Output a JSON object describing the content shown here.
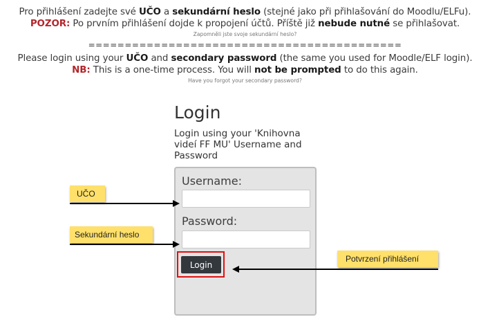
{
  "instructions_cs": {
    "l1_pre": "Pro přihlášení zadejte své ",
    "l1_uco": "UČO",
    "l1_mid": " a ",
    "l1_sec": "sekundární heslo",
    "l1_post": " (stejné jako při přihlašování do Moodlu/ELFu).",
    "l2_pozor": "POZOR:",
    "l2_text": " Po prvním přihlášení dojde k propojení účtů. Příště již ",
    "l2_bold": "nebude nutné",
    "l2_post": " se přihlašovat.",
    "forgot_link": "Zapomněli jste svoje sekundární heslo?"
  },
  "separator": "===========================================",
  "instructions_en": {
    "l1_pre": "Please login using your ",
    "l1_uco": "UČO",
    "l1_mid": " and ",
    "l1_sec": "secondary password",
    "l1_post": " (the same you used for Moodle/ELF login).",
    "l2_nb": "NB:",
    "l2_text": " This is a one-time process. You will ",
    "l2_bold": "not be prompted",
    "l2_post": " to do this again.",
    "forgot_link": "Have you forgot your secondary password?"
  },
  "login": {
    "title": "Login",
    "description": "Login using your 'Knihovna videí FF MU' Username and Password",
    "username_label": "Username:",
    "username_value": "",
    "password_label": "Password:",
    "password_value": "",
    "submit_label": "Login"
  },
  "annotations": {
    "uco": "UČO",
    "secondary_password": "Sekundární heslo",
    "confirm": "Potvrzení přihlášení"
  }
}
